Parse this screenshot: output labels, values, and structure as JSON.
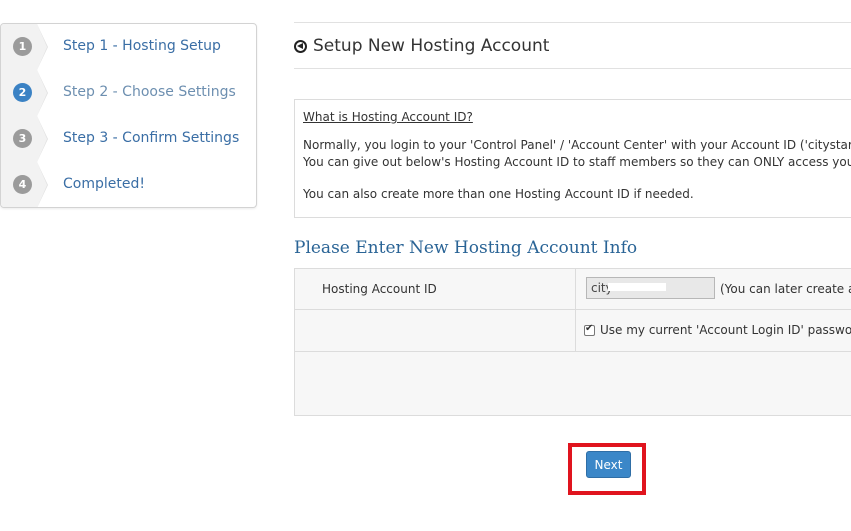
{
  "wizard": {
    "steps": [
      {
        "number": "1",
        "label": "Step 1 - Hosting Setup"
      },
      {
        "number": "2",
        "label": "Step 2 - Choose Settings"
      },
      {
        "number": "3",
        "label": "Step 3 - Confirm Settings"
      },
      {
        "number": "4",
        "label": "Completed!"
      }
    ]
  },
  "page": {
    "title": "Setup New Hosting Account",
    "title_icon": "circle-arrow-left-icon"
  },
  "info": {
    "heading": "What is Hosting Account ID?",
    "line1": "Normally, you login to your 'Control Panel' / 'Account Center' with your Account ID ('citystarit'). How",
    "line2": "You can give out below's Hosting Account ID to staff members so they can ONLY access your hostin",
    "line3": "You can also create more than one Hosting Account ID if needed."
  },
  "form": {
    "section_title": "Please Enter New Hosting Account Info",
    "account_id_label": "Hosting Account ID",
    "account_id_value": "city",
    "account_id_note": "(You can later create ad",
    "use_password_label": "Use my current 'Account Login ID' password.",
    "use_password_checked": true,
    "next_label": "Next"
  },
  "colors": {
    "link": "#3a6ea5",
    "active_step": "#3b82c4",
    "button": "#3b87c8",
    "highlight": "#e0141e",
    "section_title": "#2a6496"
  }
}
